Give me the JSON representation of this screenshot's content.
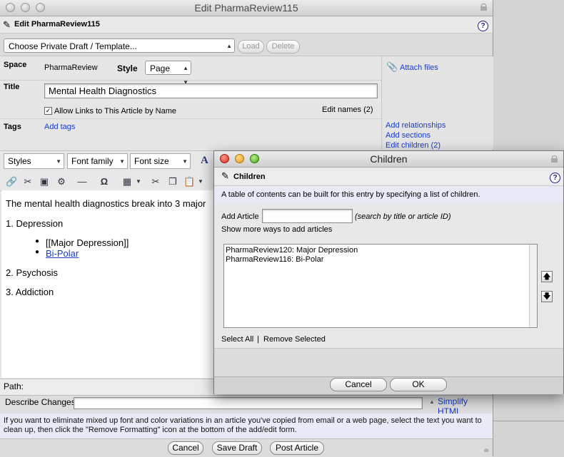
{
  "main": {
    "window_title": "Edit PharmaReview115",
    "heading": "Edit PharmaReview115",
    "template_select": "Choose Private Draft / Template...",
    "load_label": "Load",
    "delete_label": "Delete",
    "space_label": "Space",
    "space_value": "PharmaReview",
    "style_label": "Style",
    "style_value": "Page",
    "title_label": "Title",
    "title_value": "Mental Health Diagnostics",
    "allow_links_label": "Allow Links to This Article by Name",
    "edit_names": "Edit names (2)",
    "tags_label": "Tags",
    "add_tags": "Add tags",
    "attach_files": "Attach files",
    "add_relationships": "Add relationships",
    "add_sections": "Add sections",
    "edit_children": "Edit children (2)"
  },
  "toolbar": {
    "styles": "Styles",
    "font_family": "Font family",
    "font_size": "Font size"
  },
  "editor": {
    "intro": "The mental health diagnostics break into 3 major",
    "item1": "1. Depression",
    "sub1": "[[Major Depression]]",
    "sub2": "Bi-Polar",
    "item2": "2. Psychosis",
    "item3": "3. Addiction",
    "path_label": "Path:"
  },
  "bottom": {
    "describe_label": "Describe Changes:",
    "simplify": "Simplify HTML",
    "info": "If you want to eliminate mixed up font and color variations in an article you've copied from email or a web page, select the text you want to clean up, then click the \"Remove Formatting\" icon at the bottom of the add/edit form.",
    "cancel": "Cancel",
    "save_draft": "Save Draft",
    "post": "Post Article"
  },
  "children": {
    "window_title": "Children",
    "heading": "Children",
    "description": "A table of contents can be built for this entry by specifying a list of children.",
    "add_article_label": "Add Article",
    "search_hint": "(search by title or article ID)",
    "more_ways": "Show more ways to add articles",
    "items": [
      "PharmaReview120: Major Depression",
      "PharmaReview116: Bi-Polar"
    ],
    "select_all": "Select All",
    "separator": "|",
    "remove_selected": "Remove Selected",
    "cancel": "Cancel",
    "ok": "OK"
  },
  "colors": {
    "link": "#1a3cc7",
    "info_bg": "#e9eaf7"
  }
}
